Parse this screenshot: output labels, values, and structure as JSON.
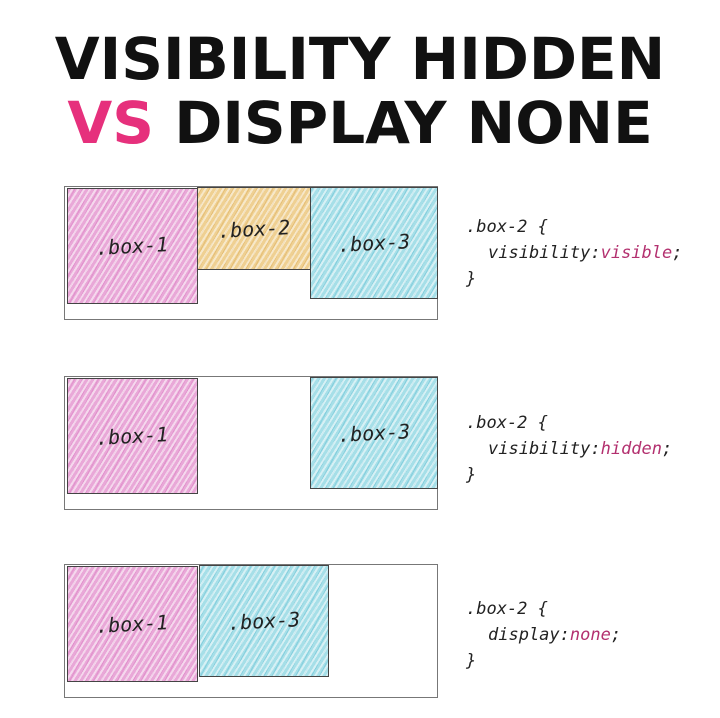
{
  "title": {
    "line1": "VISIBILITY HIDDEN",
    "line2_accent": "VS",
    "line2_rest": "DISPLAY NONE"
  },
  "colors": {
    "accent": "#e6307c",
    "box1": "#e9a8d8",
    "box2": "#efd092",
    "box3": "#a6dfe8",
    "code_value": "#b3306f"
  },
  "examples": [
    {
      "boxes": [
        ".box-1",
        ".box-2",
        ".box-3"
      ],
      "code": {
        "selector": ".box-2 {",
        "property": "visibility:",
        "value": "visible",
        "end": ";",
        "close": "}"
      }
    },
    {
      "boxes": [
        ".box-1",
        ".box-3"
      ],
      "code": {
        "selector": ".box-2 {",
        "property": "visibility:",
        "value": "hidden",
        "end": ";",
        "close": "}"
      }
    },
    {
      "boxes": [
        ".box-1",
        ".box-3"
      ],
      "code": {
        "selector": ".box-2 {",
        "property": "display:",
        "value": "none",
        "end": ";",
        "close": "}"
      }
    }
  ]
}
